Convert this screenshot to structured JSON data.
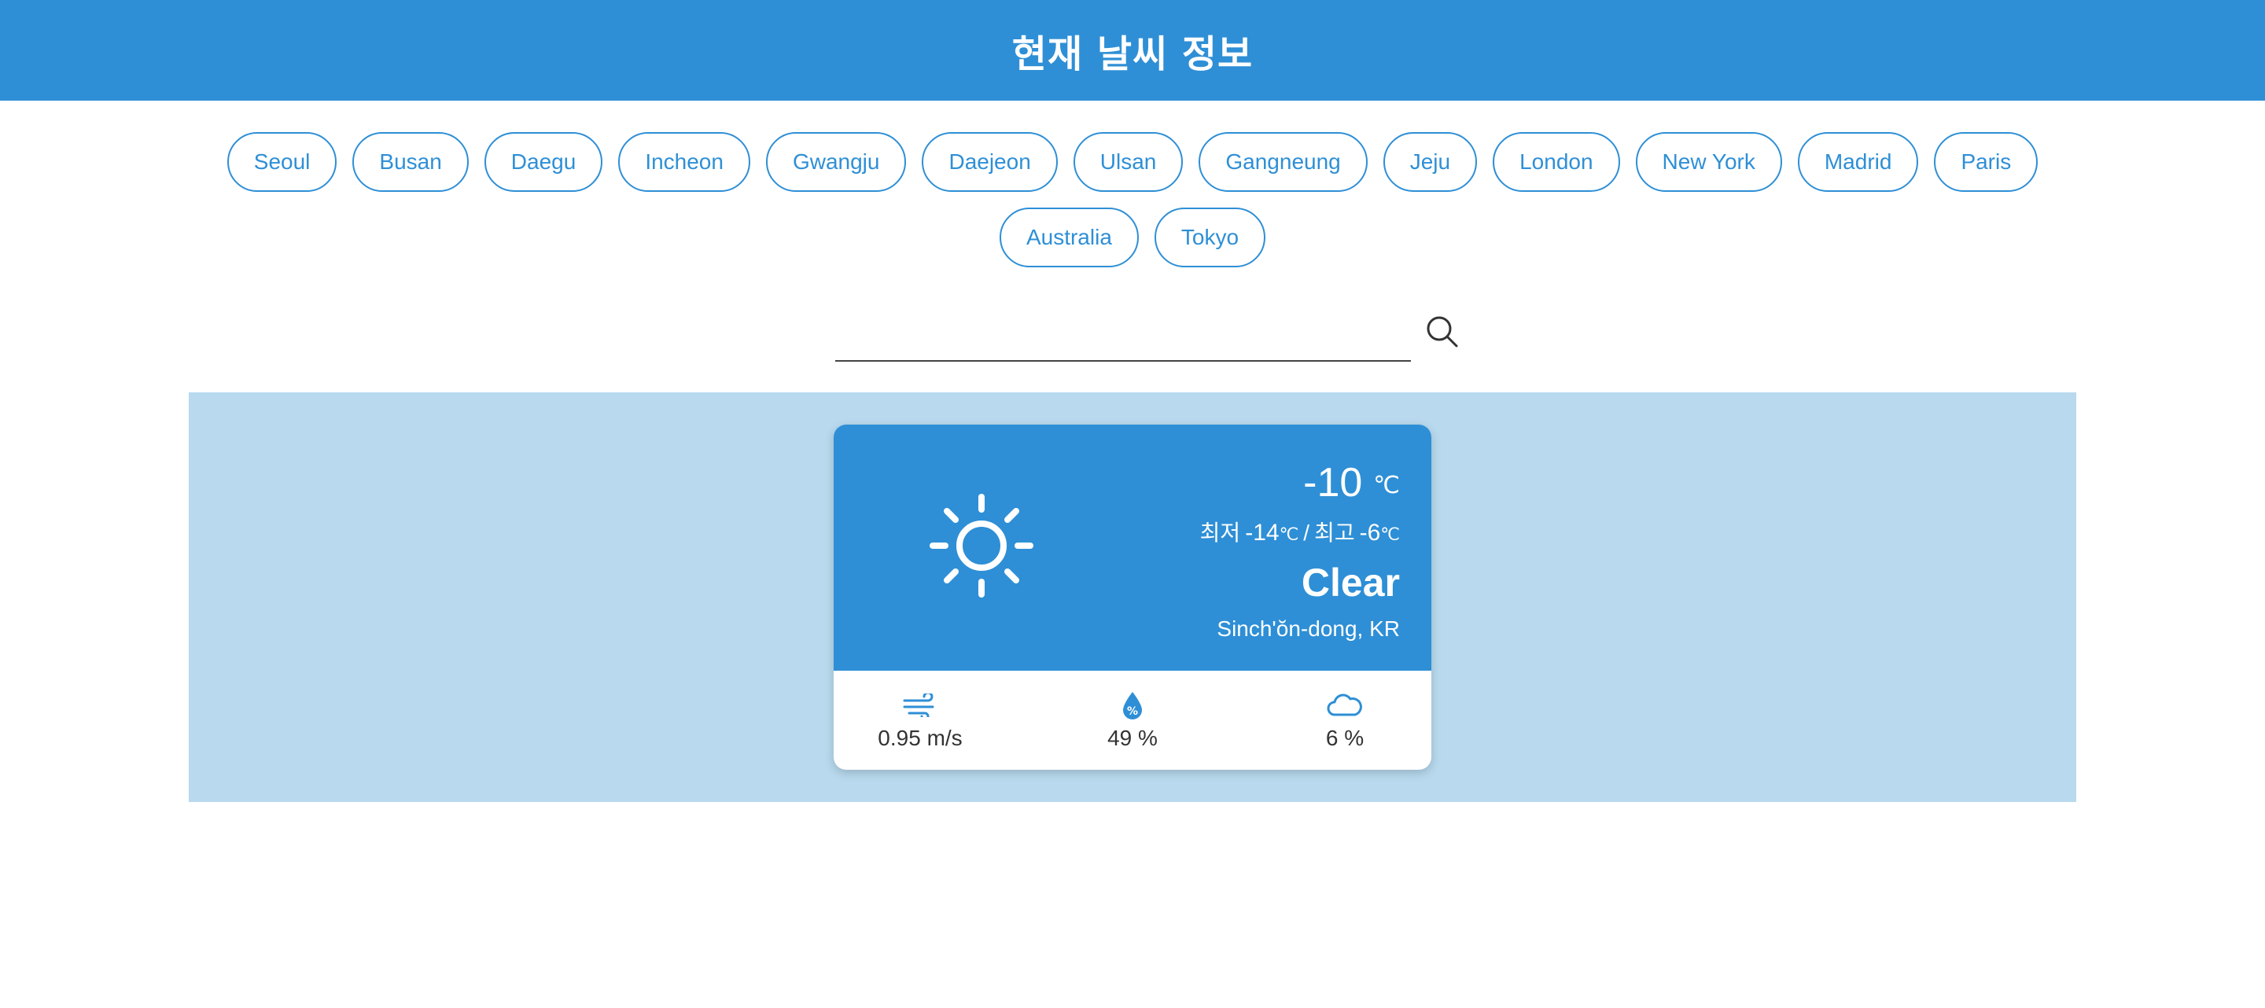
{
  "header": {
    "title": "현재 날씨 정보"
  },
  "cities": [
    "Seoul",
    "Busan",
    "Daegu",
    "Incheon",
    "Gwangju",
    "Daejeon",
    "Ulsan",
    "Gangneung",
    "Jeju",
    "London",
    "New York",
    "Madrid",
    "Paris",
    "Australia",
    "Tokyo"
  ],
  "search": {
    "value": "",
    "placeholder": "",
    "icon": "search-icon"
  },
  "weather": {
    "icon": "sun-icon",
    "temp": "-10",
    "unit": "℃",
    "min_label": "최저",
    "min_value": "-14",
    "max_label": "최고",
    "max_value": "-6",
    "separator": "/",
    "condition": "Clear",
    "location": "Sinch'ŏn-dong, KR"
  },
  "stats": {
    "wind": {
      "icon": "wind-icon",
      "value": "0.95 m/s"
    },
    "humidity": {
      "icon": "humidity-drop-icon",
      "value": "49 %"
    },
    "clouds": {
      "icon": "cloud-icon",
      "value": "6 %"
    }
  },
  "colors": {
    "primary": "#2e8fd6",
    "stage_bg": "#b8d9ee",
    "white": "#ffffff"
  }
}
